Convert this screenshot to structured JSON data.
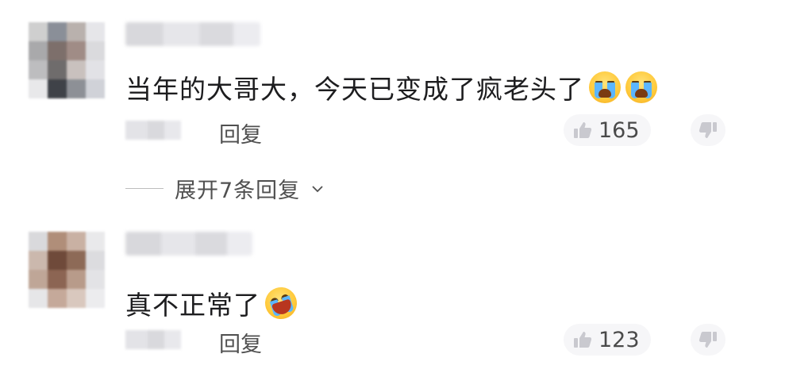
{
  "comments": [
    {
      "text": "当年的大哥大，今天已变成了疯老头了",
      "emojis": [
        "crying-face",
        "crying-face"
      ],
      "reply_label": "回复",
      "like_count": "165",
      "expand_label": "展开7条回复"
    },
    {
      "text": "真不正常了",
      "emojis": [
        "rolling-laughing-face"
      ],
      "reply_label": "回复",
      "like_count": "123"
    }
  ],
  "colors": {
    "emoji_yellow": "#ffc93a",
    "text": "#1d1d1f",
    "muted": "#505050",
    "pill_bg": "#f6f6f8"
  }
}
